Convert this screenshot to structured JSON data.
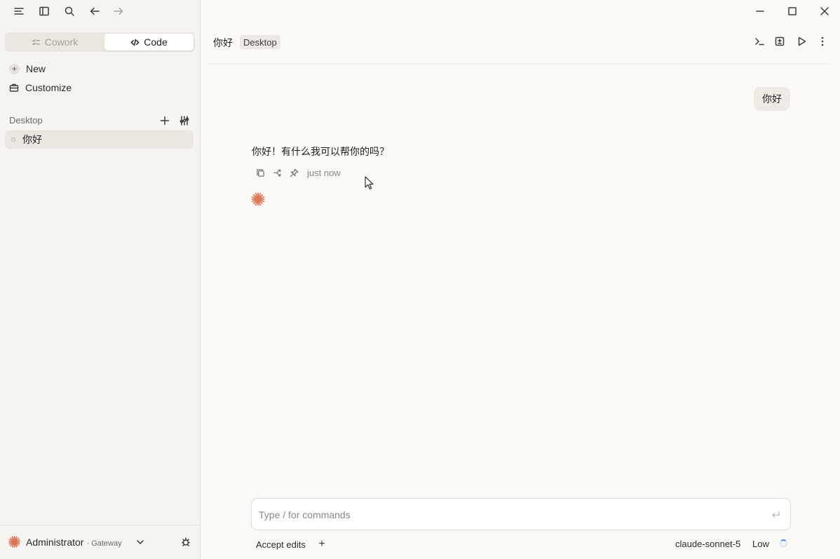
{
  "sidebar": {
    "mode_tabs": [
      {
        "label": "Cowork",
        "active": false
      },
      {
        "label": "Code",
        "active": true
      }
    ],
    "nav": [
      {
        "label": "New",
        "icon": "plus-icon"
      },
      {
        "label": "Customize",
        "icon": "briefcase-icon"
      }
    ],
    "section_label": "Desktop",
    "sessions": [
      {
        "title": "你好"
      }
    ],
    "user": {
      "name": "Administrator",
      "sub": "· Gateway"
    }
  },
  "main": {
    "title": "你好",
    "tag": "Desktop",
    "messages": {
      "user": "你好",
      "assistant": "你好！有什么我可以帮你的吗？",
      "time": "just now"
    },
    "composer": {
      "placeholder": "Type / for commands"
    },
    "bottom": {
      "accept_edits": "Accept edits",
      "model": "claude-sonnet-5",
      "effort": "Low"
    }
  },
  "colors": {
    "accent": "#d97757",
    "background": "#faf9f5",
    "sidebar": "#f5f4ef"
  }
}
